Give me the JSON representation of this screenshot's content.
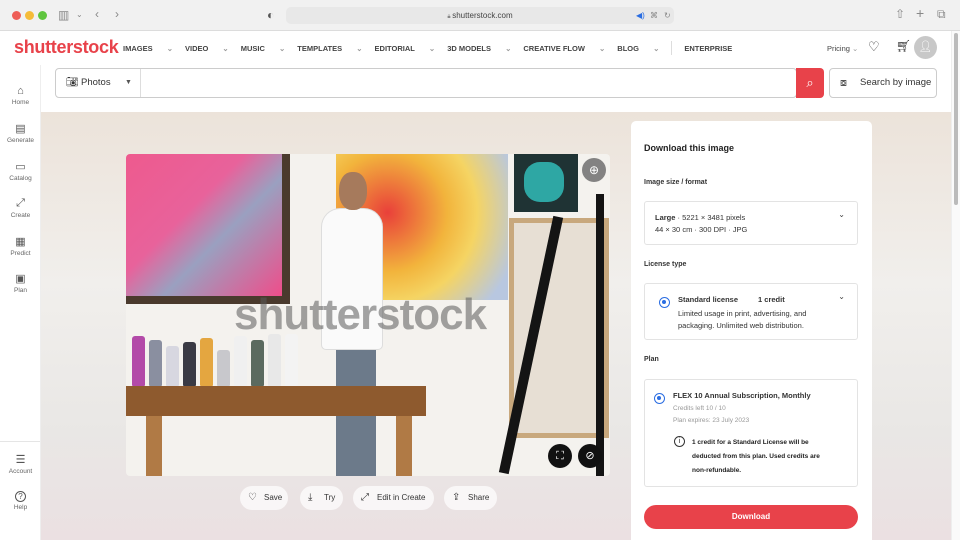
{
  "browser": {
    "url": "shutterstock.com",
    "lock_icon": "lock-icon"
  },
  "nav": {
    "logo": "shutterstock",
    "menu": [
      {
        "label": "IMAGES",
        "caret": true
      },
      {
        "label": "VIDEO",
        "caret": true
      },
      {
        "label": "MUSIC",
        "caret": true
      },
      {
        "label": "TEMPLATES",
        "caret": true
      },
      {
        "label": "EDITORIAL",
        "caret": true
      },
      {
        "label": "3D MODELS",
        "caret": true
      },
      {
        "label": "CREATIVE FLOW",
        "caret": true
      },
      {
        "label": "BLOG",
        "caret": true
      },
      {
        "label": "ENTERPRISE",
        "caret": false
      }
    ],
    "pricing": "Pricing",
    "caret": "⌄"
  },
  "sidebar": {
    "items": [
      {
        "label": "Home",
        "icon": "⌂"
      },
      {
        "label": "Generate",
        "icon": "▤"
      },
      {
        "label": "Catalog",
        "icon": "▭"
      },
      {
        "label": "Create",
        "icon": "⤢"
      },
      {
        "label": "Predict",
        "icon": "▦"
      },
      {
        "label": "Plan",
        "icon": "▣"
      }
    ],
    "bottom": [
      {
        "label": "Account",
        "icon": "☰"
      },
      {
        "label": "Help",
        "icon": "?"
      }
    ]
  },
  "search": {
    "type": "Photos",
    "placeholder": "",
    "search_by_image": "Search by image"
  },
  "image": {
    "watermark": "shutterstock"
  },
  "actions": [
    {
      "label": "Save",
      "icon": "♡"
    },
    {
      "label": "Try",
      "icon": "⤓"
    },
    {
      "label": "Edit in Create",
      "icon": "⤢"
    },
    {
      "label": "Share",
      "icon": "⇪"
    }
  ],
  "panel": {
    "title": "Download this image",
    "size_label": "Image size / format",
    "size_name": "Large",
    "size_pixels": " · 5221 × 3481 pixels",
    "size_detail": "44 × 30 cm · 300 DPI · JPG",
    "license_label": "License type",
    "license_name": "Standard license",
    "license_credits": "1 credit",
    "license_desc": "Limited usage in print, advertising, and packaging. Unlimited web distribution.",
    "plan_label": "Plan",
    "plan_name": "FLEX 10 Annual Subscription, Monthly",
    "credits_left": "Credits left 10 / 10",
    "plan_expires": "Plan expires: 23 July 2023",
    "notice": "1 credit for a Standard License will be deducted from this plan. Used credits are non-refundable.",
    "download": "Download"
  },
  "colors": {
    "brand": "#e8424a",
    "radio": "#2a6de2"
  }
}
